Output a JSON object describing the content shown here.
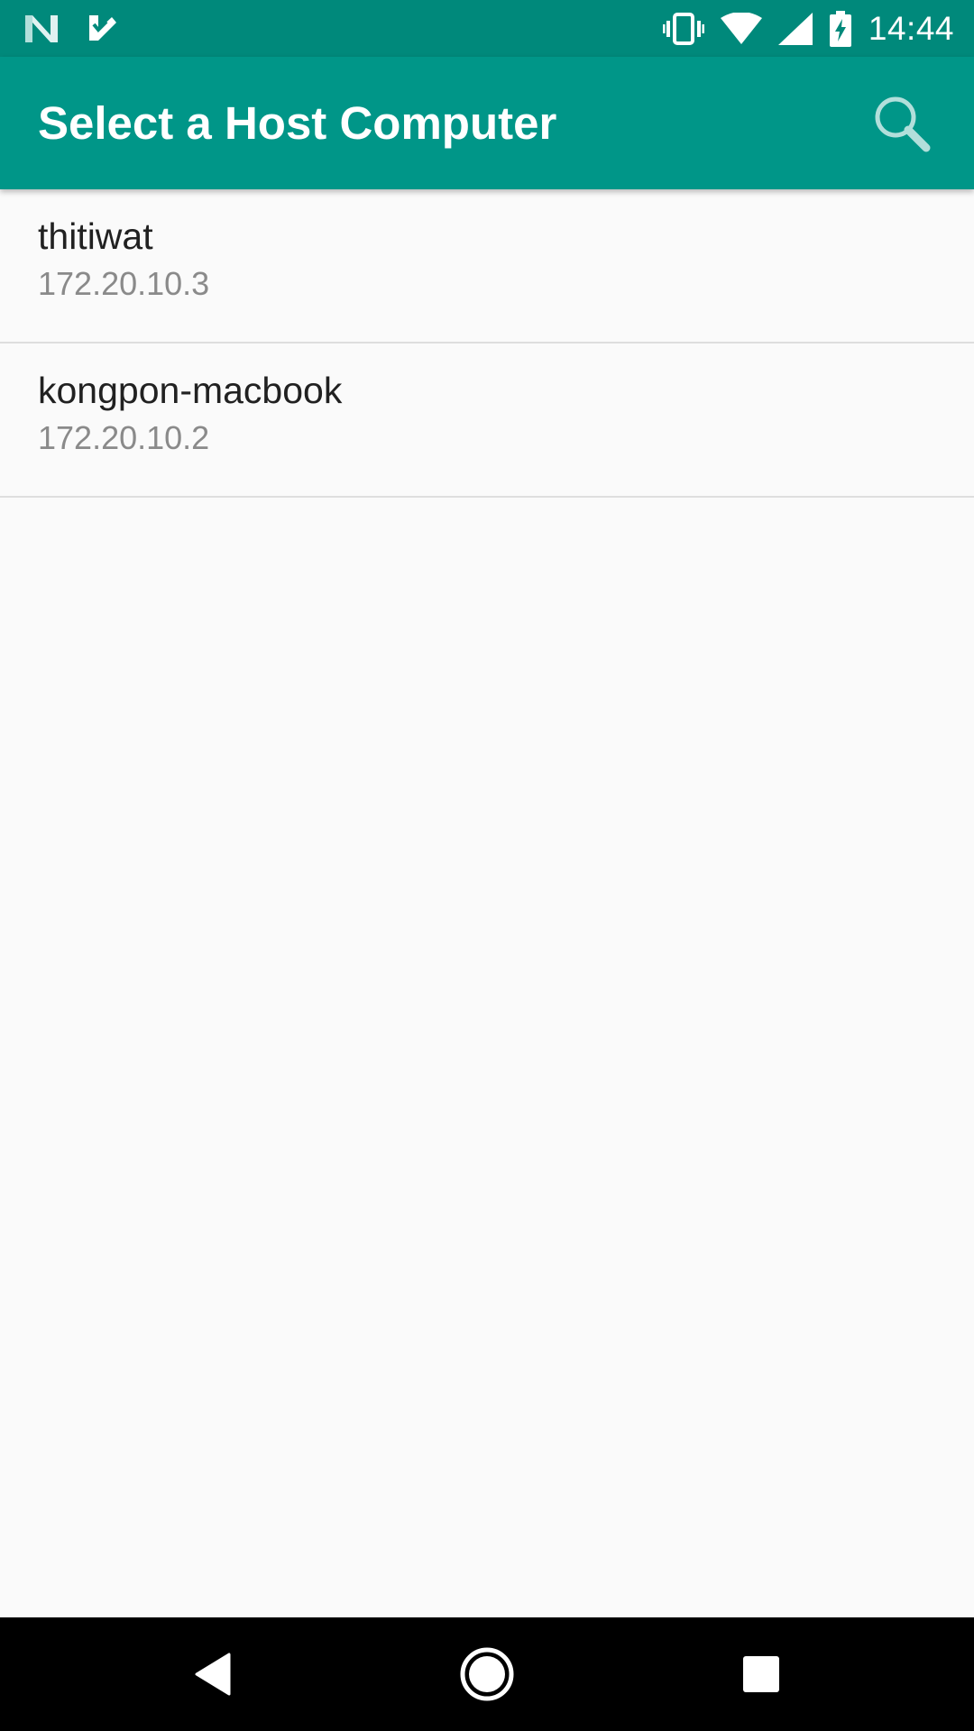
{
  "status_bar": {
    "time": "14:44",
    "left_icons": [
      "n-notification-icon",
      "check-notification-icon"
    ],
    "right_icons": [
      "vibrate-icon",
      "wifi-icon",
      "cell-signal-icon",
      "battery-charging-icon"
    ]
  },
  "app_bar": {
    "title": "Select a Host Computer",
    "action_icon": "search-icon",
    "color": "#009688"
  },
  "hosts": [
    {
      "name": "thitiwat",
      "ip": "172.20.10.3"
    },
    {
      "name": "kongpon-macbook",
      "ip": "172.20.10.2"
    }
  ],
  "nav_bar": {
    "buttons": [
      "back-icon",
      "home-icon",
      "recents-icon"
    ]
  }
}
